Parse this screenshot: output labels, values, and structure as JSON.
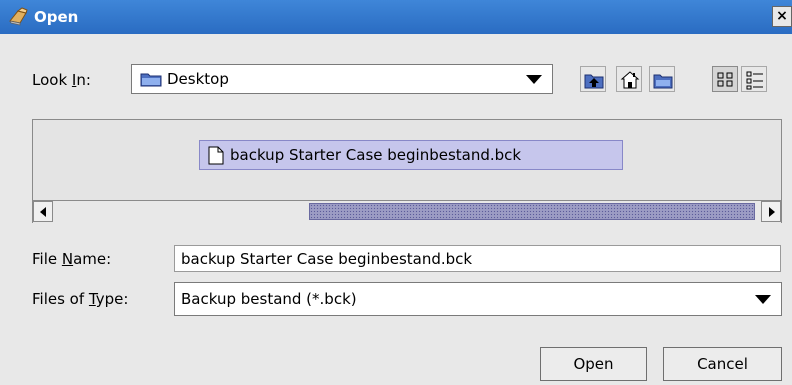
{
  "dialog": {
    "title": "Open",
    "close_glyph": "×"
  },
  "look_in": {
    "label_pre": "Look ",
    "label_mnemonic": "I",
    "label_post": "n:",
    "value": "Desktop",
    "icon": "folder-icon"
  },
  "toolbar": {
    "buttons": [
      {
        "name": "up-one-level",
        "icon": "folder-up-icon"
      },
      {
        "name": "home",
        "icon": "home-icon"
      },
      {
        "name": "create-new-folder",
        "icon": "new-folder-icon"
      },
      {
        "name": "list-view",
        "icon": "list-view-icon",
        "active": true
      },
      {
        "name": "details-view",
        "icon": "details-view-icon"
      }
    ]
  },
  "files": [
    {
      "name": "backup Starter Case beginbestand.bck",
      "selected": true,
      "icon": "file-icon"
    }
  ],
  "file_name": {
    "label_pre": "File ",
    "label_mnemonic": "N",
    "label_post": "ame:",
    "value": "backup Starter Case beginbestand.bck"
  },
  "files_of_type": {
    "label_pre": "Files of ",
    "label_mnemonic": "T",
    "label_post": "ype:",
    "value": "Backup bestand (*.bck)"
  },
  "buttons": {
    "open": "Open",
    "cancel": "Cancel"
  },
  "colors": {
    "titlebar": "#2f74cc",
    "selection": "#c6c6ec",
    "scroll_thumb": "#9c9cc4"
  }
}
